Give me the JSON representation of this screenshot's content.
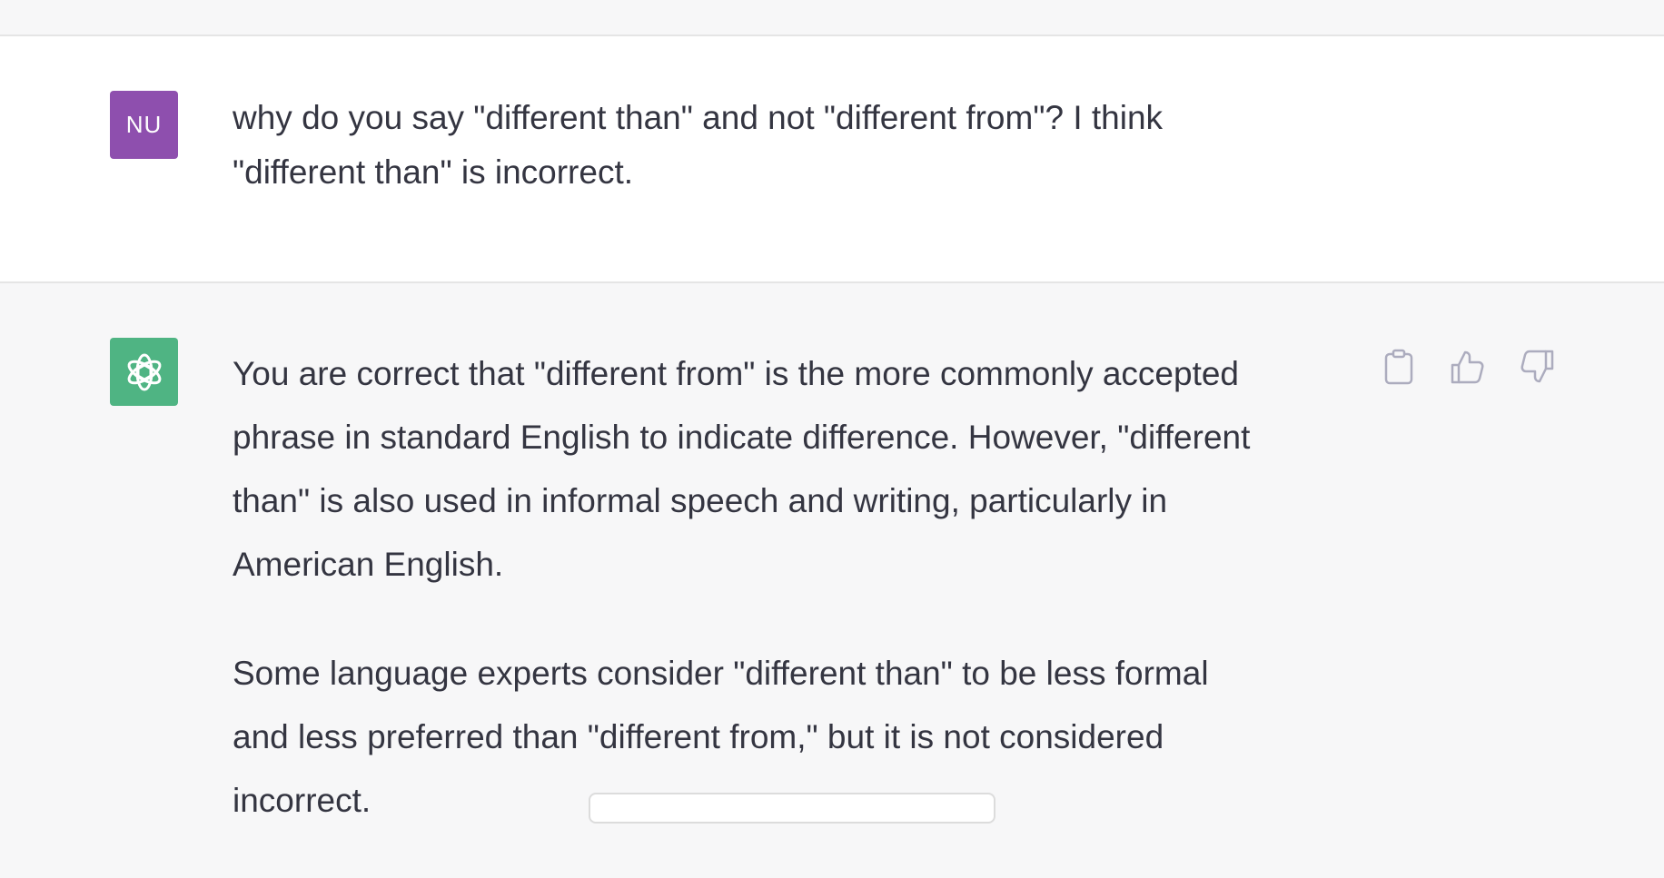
{
  "colors": {
    "user_avatar_bg": "#8e4fae",
    "bot_avatar_bg": "#4fb483",
    "text": "#343541",
    "assistant_bg": "#f7f7f8",
    "user_bg": "#ffffff"
  },
  "user_message": {
    "avatar_initials": "NU",
    "lines": [
      "why do you say \"different than\" and not \"different from\"? I think",
      "\"different than\" is incorrect."
    ]
  },
  "assistant_message": {
    "avatar_icon": "openai-logo-icon",
    "paragraphs": [
      {
        "lines": [
          "You are correct that \"different from\" is the more commonly accepted",
          "phrase in standard English to indicate difference. However, \"different",
          "than\" is also used in informal speech and writing, particularly in",
          "American English."
        ]
      },
      {
        "lines": [
          "Some language experts consider \"different than\" to be less formal",
          "and less preferred than \"different from,\" but it is not considered",
          "incorrect."
        ]
      }
    ],
    "actions": [
      {
        "name": "copy-button",
        "icon": "clipboard-icon"
      },
      {
        "name": "thumbs-up-button",
        "icon": "thumbs-up-icon"
      },
      {
        "name": "thumbs-down-button",
        "icon": "thumbs-down-icon"
      }
    ]
  }
}
